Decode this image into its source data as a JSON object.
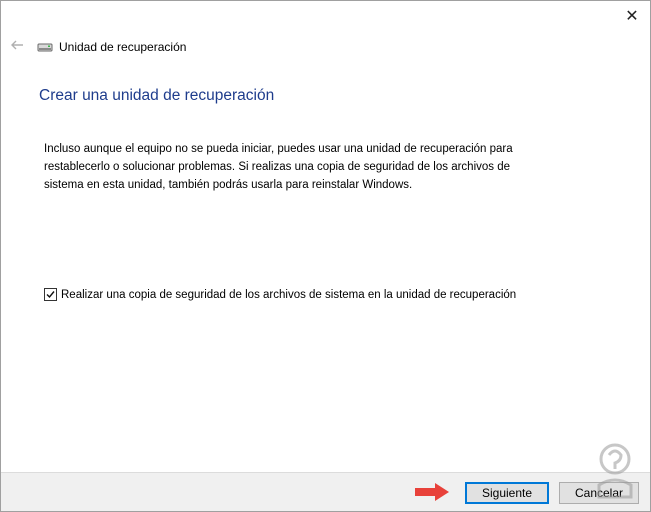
{
  "window": {
    "title": "Unidad de recuperación",
    "close_symbol": "✕"
  },
  "page": {
    "heading": "Crear una unidad de recuperación",
    "description_lines": [
      "Incluso aunque el equipo no se pueda iniciar, puedes usar una unidad de recuperación para",
      "restablecerlo o solucionar problemas. Si realizas una copia de seguridad de los archivos de",
      "sistema en esta unidad, también podrás usarla para reinstalar Windows."
    ],
    "checkbox": {
      "label": "Realizar una copia de seguridad de los archivos de sistema en la unidad de recuperación",
      "checked": true
    }
  },
  "footer": {
    "next_label": "Siguiente",
    "cancel_label": "Cancelar"
  },
  "icons": {
    "back": "back-arrow-icon",
    "drive": "drive-icon",
    "close": "close-icon",
    "check": "checkmark-icon",
    "pointer": "red-arrow-icon"
  },
  "colors": {
    "heading": "#1e3c8c",
    "accent": "#0078d7",
    "pointer_arrow": "#e8413a",
    "footer_bg": "#f0f0f0"
  }
}
